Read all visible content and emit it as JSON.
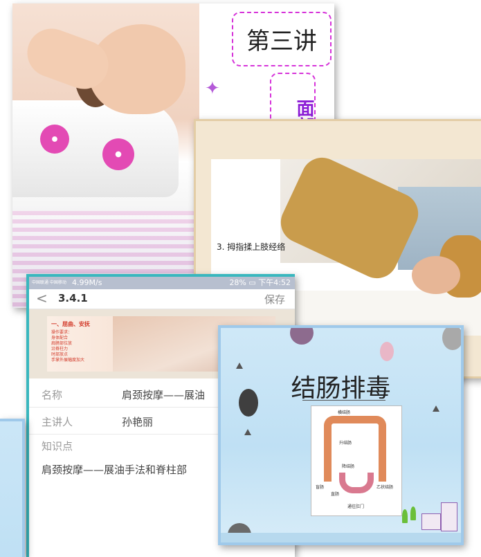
{
  "slide1": {
    "lecture_label": "第三讲",
    "vertical_title": "面部"
  },
  "slide2": {
    "caption": "3. 拇指揉上肢经络"
  },
  "phone": {
    "status": {
      "carrier": "中国联通 中国移动",
      "speed": "4.99M/s",
      "battery": "28%",
      "time": "下午4:52"
    },
    "nav": {
      "back_icon": "chevron-left-icon",
      "title": "3.4.1",
      "save_label": "保存"
    },
    "banner": {
      "heading": "一、屈曲、安抚",
      "items": [
        "操作要求：",
        "身体配合",
        "肩膀部位放",
        "沿脊柱力",
        "时部放点",
        "手掌外展幅度加大"
      ]
    },
    "fields": [
      {
        "label": "名称",
        "value": "肩颈按摩——展油"
      },
      {
        "label": "主讲人",
        "value": "孙艳丽"
      },
      {
        "label": "知识点",
        "value": ""
      }
    ],
    "knowledge_text": "肩颈按摩——展油手法和脊柱部"
  },
  "slide3": {
    "title": "结肠排毒",
    "labels": [
      "横结肠",
      "升结肠",
      "降结肠",
      "盲肠",
      "直肠",
      "乙状结肠",
      "通往肛门"
    ]
  }
}
